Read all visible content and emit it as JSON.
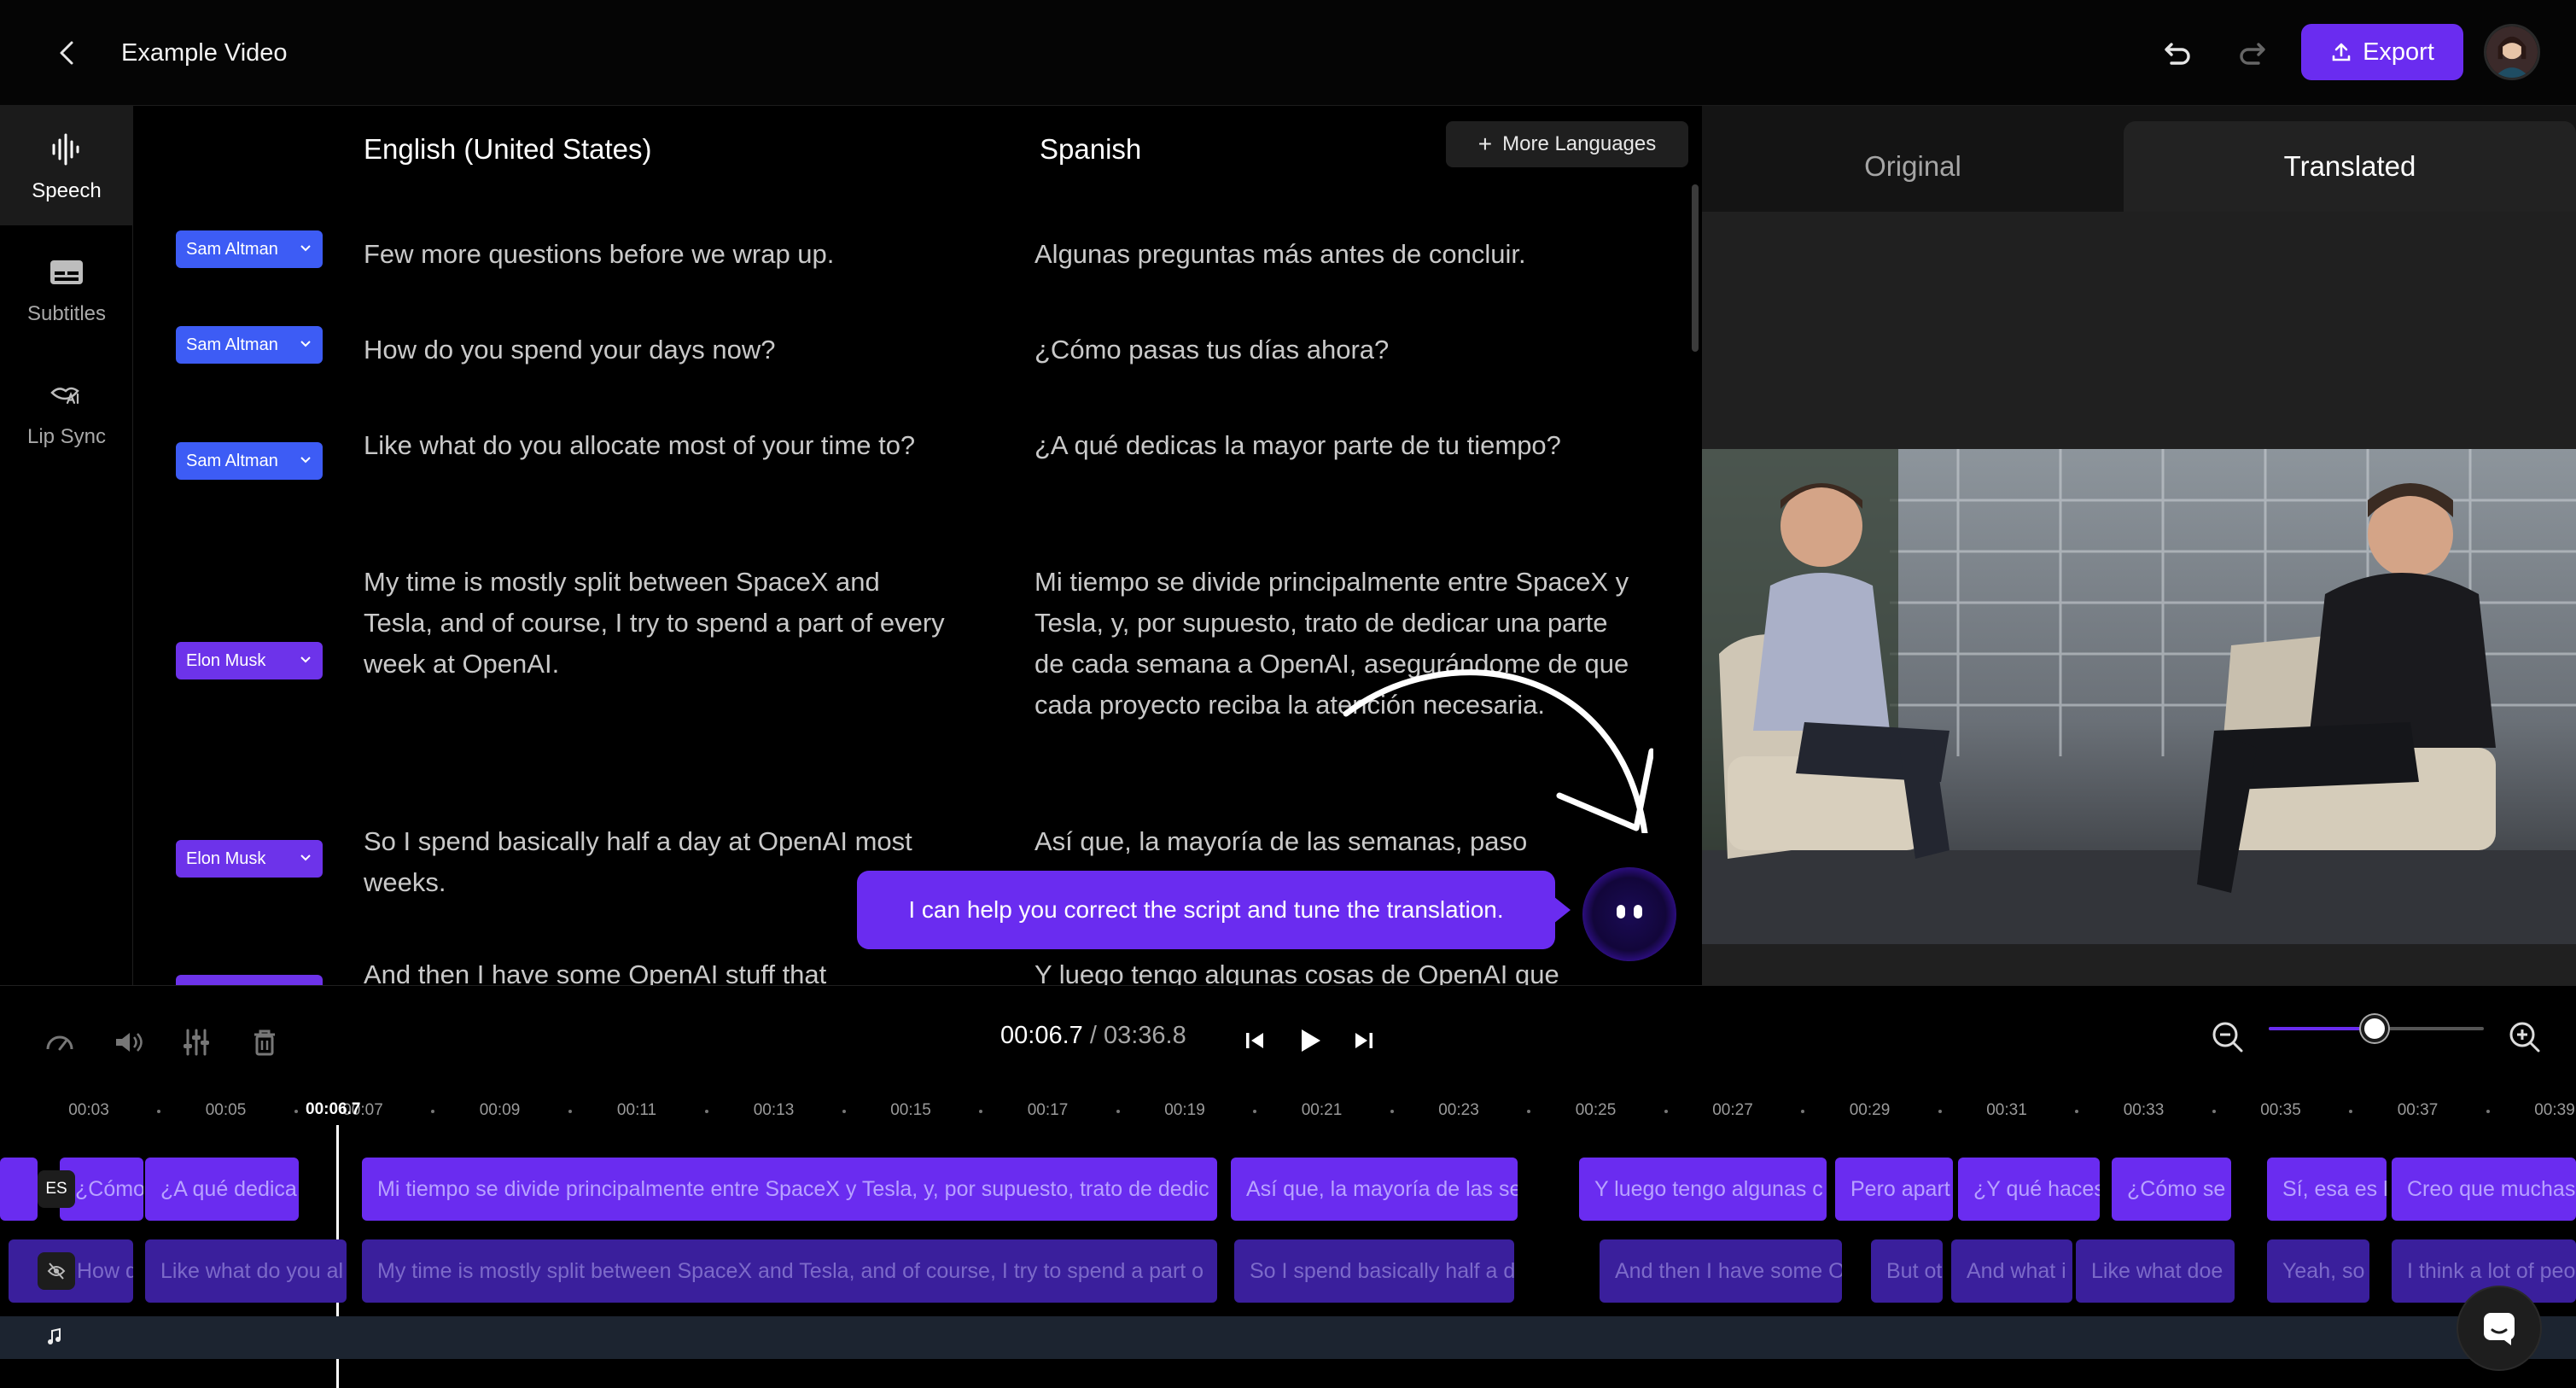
{
  "header": {
    "title": "Example Video",
    "export_label": "Export"
  },
  "nav": [
    {
      "label": "Speech",
      "icon": "waveform-icon"
    },
    {
      "label": "Subtitles",
      "icon": "subtitles-icon"
    },
    {
      "label": "Lip Sync",
      "icon": "lip-sync-icon"
    }
  ],
  "transcript": {
    "source_language": "English (United States)",
    "target_language": "Spanish",
    "more_languages_label": "More Languages",
    "rows": [
      {
        "speaker": "Sam Altman",
        "source": "Few more questions before we wrap up.",
        "target": "Algunas preguntas más antes de concluir."
      },
      {
        "speaker": "Sam Altman",
        "source": "How do you spend your days now?",
        "target": "¿Cómo pasas tus días ahora?"
      },
      {
        "speaker": "Sam Altman",
        "source": "Like what do you allocate most of your time to?",
        "target": "¿A qué dedicas la mayor parte de tu tiempo?"
      },
      {
        "speaker": "Elon Musk",
        "source": "My time is mostly split between SpaceX and Tesla, and of course, I try to spend a part of every week at OpenAI.",
        "target": "Mi tiempo se divide principalmente entre SpaceX y Tesla, y, por supuesto, trato de dedicar una parte de cada semana a OpenAI, asegurándome de que cada proyecto reciba la atención necesaria."
      },
      {
        "speaker": "Elon Musk",
        "source": "So I spend basically half a day at OpenAI most weeks.",
        "target": "Así que, la mayoría de las semanas, paso"
      },
      {
        "speaker": "",
        "source": "And then I have some OpenAI stuff that",
        "target": "Y luego tengo algunas cosas de OpenAI que"
      }
    ]
  },
  "assistant": {
    "message": "I can help you correct the script and tune the translation."
  },
  "video": {
    "tabs": [
      "Original",
      "Translated"
    ],
    "active_tab": "Translated"
  },
  "timeline": {
    "current_time": "00:06.7",
    "total_time": "03:36.8",
    "separator": " / ",
    "zoom_level": 0.49,
    "ruler": [
      "00:03",
      "00:05",
      "00:07",
      "00:09",
      "00:11",
      "00:13",
      "00:15",
      "00:17",
      "00:19",
      "00:21",
      "00:23",
      "00:25",
      "00:27",
      "00:29",
      "00:31",
      "00:33",
      "00:35",
      "00:37",
      "00:39"
    ],
    "track_badge_es": "ES",
    "es_clips": [
      "¿Cómo pa",
      "¿A qué dedica",
      "Mi tiempo se divide principalmente entre SpaceX y Tesla, y, por supuesto, trato de dedic",
      "Así que, la mayoría de las se",
      "Y luego tengo algunas c",
      "Pero apart",
      "¿Y qué haces",
      "¿Cómo se v",
      "Sí, esa es l",
      "Creo que muchas"
    ],
    "en_clips": [
      "How do you",
      "Like what do you al",
      "My time is mostly split between SpaceX and Tesla, and of course, I try to spend a part o",
      "So I spend basically half a d",
      "And then I have some O",
      "But ot",
      "And what i",
      "Like what doe",
      "Yeah, so",
      "I think a lot of peo"
    ]
  },
  "colors": {
    "accent": "#6a2cf0",
    "speaker_sam": "#3d5cf5",
    "speaker_elon": "#6d33ea"
  }
}
